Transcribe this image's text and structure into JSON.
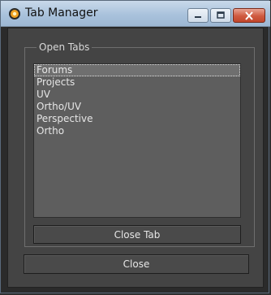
{
  "window": {
    "title": "Tab Manager",
    "icons": {
      "app": "app-logo-icon",
      "minimize": "minimize-icon",
      "maximize": "maximize-icon",
      "close": "close-icon"
    }
  },
  "group": {
    "label": "Open Tabs",
    "items": [
      {
        "label": "Forums",
        "selected": true
      },
      {
        "label": "Projects",
        "selected": false
      },
      {
        "label": "UV",
        "selected": false
      },
      {
        "label": "Ortho/UV",
        "selected": false
      },
      {
        "label": "Perspective",
        "selected": false
      },
      {
        "label": "Ortho",
        "selected": false
      }
    ],
    "close_tab_label": "Close Tab"
  },
  "footer": {
    "close_label": "Close"
  },
  "colors": {
    "titlebar": "#a9c2dc",
    "close_button": "#cf5a3f",
    "panel": "#444444",
    "list_bg": "#5e5e5e"
  }
}
